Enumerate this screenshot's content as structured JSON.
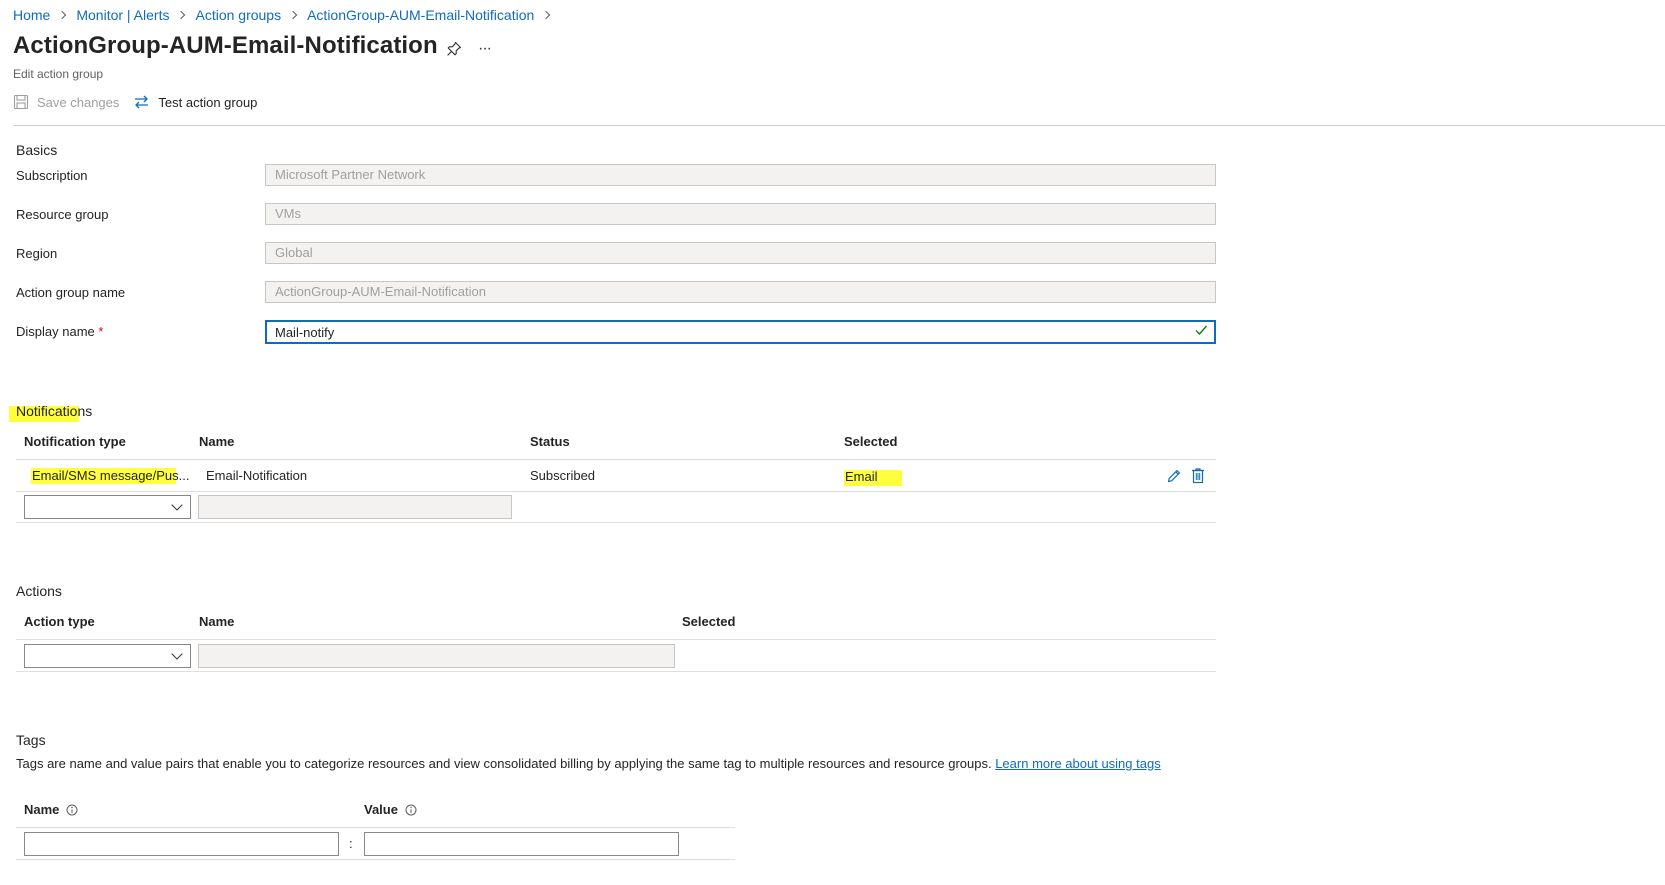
{
  "breadcrumb": [
    {
      "label": "Home"
    },
    {
      "label": "Monitor | Alerts"
    },
    {
      "label": "Action groups"
    },
    {
      "label": "ActionGroup-AUM-Email-Notification"
    }
  ],
  "header": {
    "title": "ActionGroup-AUM-Email-Notification",
    "subtitle": "Edit action group",
    "more_label": "···"
  },
  "toolbar": {
    "save_label": "Save changes",
    "test_label": "Test action group"
  },
  "basics": {
    "section_title": "Basics",
    "subscription": {
      "label": "Subscription",
      "value": "Microsoft Partner Network"
    },
    "resource_group": {
      "label": "Resource group",
      "value": "VMs"
    },
    "region": {
      "label": "Region",
      "value": "Global"
    },
    "action_group_name": {
      "label": "Action group name",
      "value": "ActionGroup-AUM-Email-Notification"
    },
    "display_name": {
      "label": "Display name",
      "required_mark": "*",
      "value": "Mail-notify"
    }
  },
  "notifications": {
    "section_title": "Notifications",
    "columns": {
      "type": "Notification type",
      "name": "Name",
      "status": "Status",
      "selected": "Selected"
    },
    "rows": [
      {
        "type": "Email/SMS message/Pus...",
        "name": "Email-Notification",
        "status": "Subscribed",
        "selected": "Email"
      }
    ]
  },
  "actions": {
    "section_title": "Actions",
    "columns": {
      "type": "Action type",
      "name": "Name",
      "selected": "Selected"
    }
  },
  "tags": {
    "section_title": "Tags",
    "description": "Tags are name and value pairs that enable you to categorize resources and view consolidated billing by applying the same tag to multiple resources and resource groups.",
    "learn_more": "Learn more about using tags",
    "columns": {
      "name": "Name",
      "value": "Value"
    },
    "separator": ":"
  },
  "colors": {
    "accent": "#0f6cbd",
    "highlight": "#ffff3d",
    "success": "#107c10"
  }
}
